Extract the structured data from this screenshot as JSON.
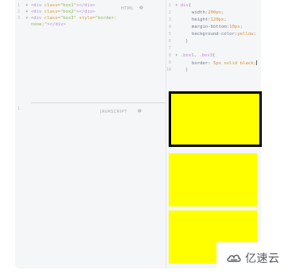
{
  "html_pane": {
    "label": "HTML",
    "lines": [
      {
        "num": "1",
        "open": "<div ",
        "attr": "class=",
        "str": "\"box1\"",
        "close": "></div>"
      },
      {
        "num": "2",
        "open": "<div ",
        "attr": "class=",
        "str": "\"box2\"",
        "close": "></div>"
      },
      {
        "num": "3",
        "open": "<div ",
        "attr": "class=",
        "str": "\"box3\"",
        "attr2": " style=",
        "str2": "\"border:"
      },
      {
        "num": "",
        "cont": "none;\"",
        "close": "></div>"
      }
    ]
  },
  "js_pane": {
    "label": "JAVASCRIPT",
    "lines": [
      {
        "num": "1",
        "text": ""
      }
    ]
  },
  "css_pane": {
    "lines": [
      {
        "num": "1",
        "sel": "div",
        "brace": "{"
      },
      {
        "num": "2",
        "prop": "width:",
        "val": "200px",
        "semi": ";"
      },
      {
        "num": "3",
        "prop": "height:",
        "val": "120px",
        "semi": ";"
      },
      {
        "num": "4",
        "prop": "margin-bottom:",
        "val": "10px",
        "semi": ";"
      },
      {
        "num": "5",
        "prop": "background-color:",
        "val": "yellow",
        "semi": ";"
      },
      {
        "num": "6",
        "brace": "}"
      },
      {
        "num": "7",
        "text": ""
      },
      {
        "num": "8",
        "sel": ".box1, .box3",
        "brace": "{"
      },
      {
        "num": "9",
        "prop": "border:",
        "val": "5px solid black",
        "semi": ";"
      },
      {
        "num": "10",
        "brace": "}"
      }
    ]
  },
  "result_pane": {
    "boxes": [
      {
        "name": "box1",
        "color": "#ffff00",
        "border": "black"
      },
      {
        "name": "box2",
        "color": "#ffff00",
        "border": "none"
      },
      {
        "name": "box3",
        "color": "#ffff00",
        "border": "none"
      }
    ]
  },
  "watermark": {
    "text": "亿速云",
    "icon": "cloud-logo-icon"
  },
  "colors": {
    "editor_bg": "#f5f6f7",
    "box_yellow": "#ffff00",
    "border": "#000000"
  }
}
